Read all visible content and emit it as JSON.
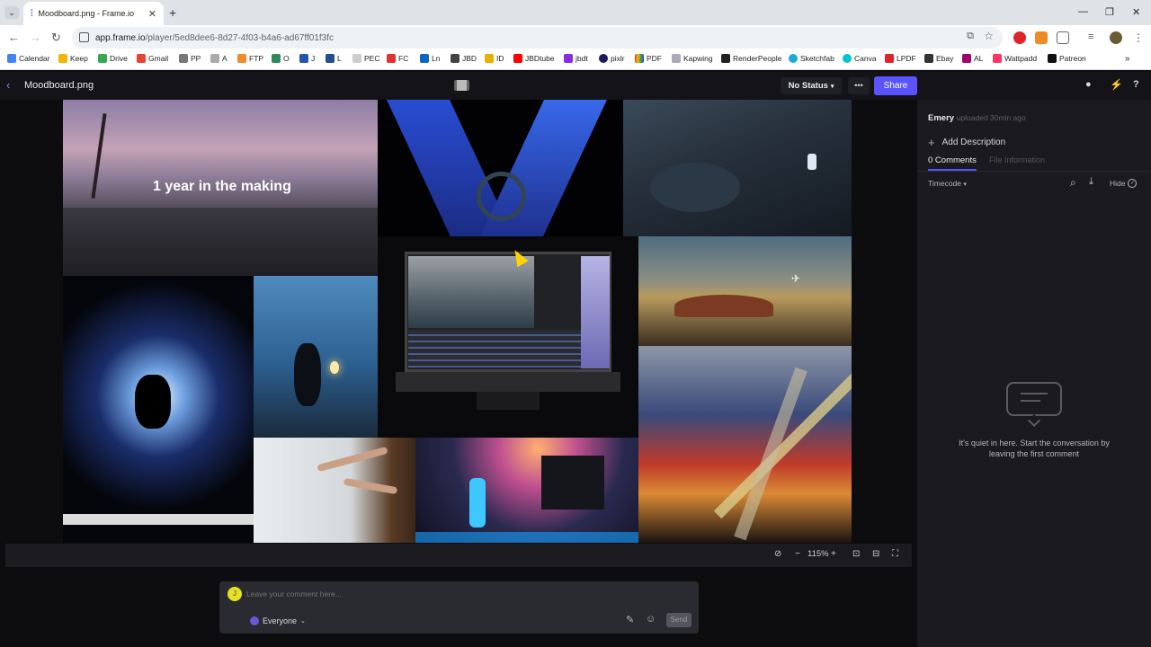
{
  "browser": {
    "tab_title": "Moodboard.png - Frame.io",
    "url_host": "app.frame.io",
    "url_path": "/player/5ed8dee6-8d27-4f03-b4a6-ad67ff01f3fc",
    "bookmarks": [
      "Calendar",
      "Keep",
      "Drive",
      "Gmail",
      "PP",
      "A",
      "FTP",
      "O",
      "J",
      "L",
      "PEC",
      "FC",
      "Ln",
      "JBD",
      "ID",
      "JBDtube",
      "jbdt",
      "pixlr",
      "PDF",
      "Kapwing",
      "RenderPeople",
      "Sketchfab",
      "Canva",
      "LPDF",
      "Ebay",
      "AL",
      "Wattpadd",
      "Patreon"
    ]
  },
  "header": {
    "file_name": "Moodboard.png",
    "status_label": "No Status",
    "more_label": "•••",
    "share_label": "Share"
  },
  "image": {
    "overlay_text": "1 year in the making"
  },
  "controls": {
    "zoom": "115%"
  },
  "comment": {
    "avatar_initial": "J",
    "placeholder": "Leave your comment here...",
    "audience": "Everyone",
    "send_label": "Send"
  },
  "sidebar": {
    "uploader": "Emery",
    "uploaded_meta": "uploaded 30min ago",
    "add_description": "Add Description",
    "tab_comments": "0 Comments",
    "tab_info": "File Information",
    "timecode_label": "Timecode",
    "hide_label": "Hide",
    "empty_message": "It's quiet in here. Start the conversation by leaving the first comment"
  },
  "colors": {
    "accent": "#5b53ff",
    "app_bg": "#0d0d10",
    "panel_bg": "#1a1a1f"
  }
}
